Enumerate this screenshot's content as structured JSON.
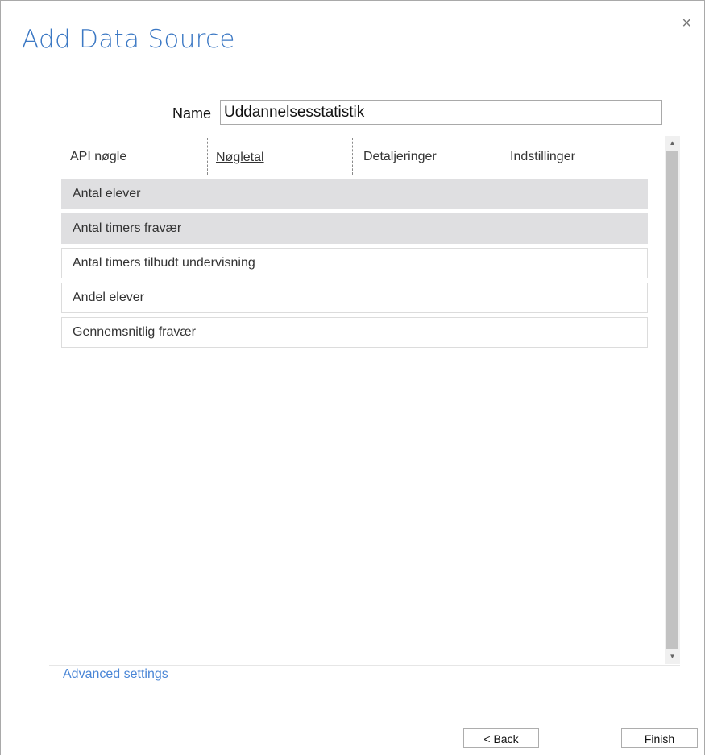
{
  "dialog": {
    "title": "Add Data Source",
    "close_glyph": "×",
    "close_icon": "close-icon"
  },
  "name_field": {
    "label": "Name",
    "value": "Uddannelsesstatistik"
  },
  "tabs": [
    {
      "label": "API nøgle",
      "active": false
    },
    {
      "label": "Nøgletal",
      "active": true
    },
    {
      "label": "Detaljeringer",
      "active": false
    },
    {
      "label": "Indstillinger",
      "active": false
    }
  ],
  "metrics": [
    {
      "label": "Antal elever",
      "selected": true
    },
    {
      "label": "Antal timers fravær",
      "selected": true
    },
    {
      "label": "Antal timers tilbudt undervisning",
      "selected": false
    },
    {
      "label": "Andel elever",
      "selected": false
    },
    {
      "label": "Gennemsnitlig fravær",
      "selected": false
    }
  ],
  "scrollbar": {
    "up_glyph": "▲",
    "down_glyph": "▼"
  },
  "advanced_settings_label": "Advanced settings",
  "footer": {
    "back_label": "< Back",
    "finish_label": "Finish"
  },
  "colors": {
    "title": "#3b78c4",
    "link": "#4a86d6",
    "selected_row": "#dfdfe1"
  }
}
